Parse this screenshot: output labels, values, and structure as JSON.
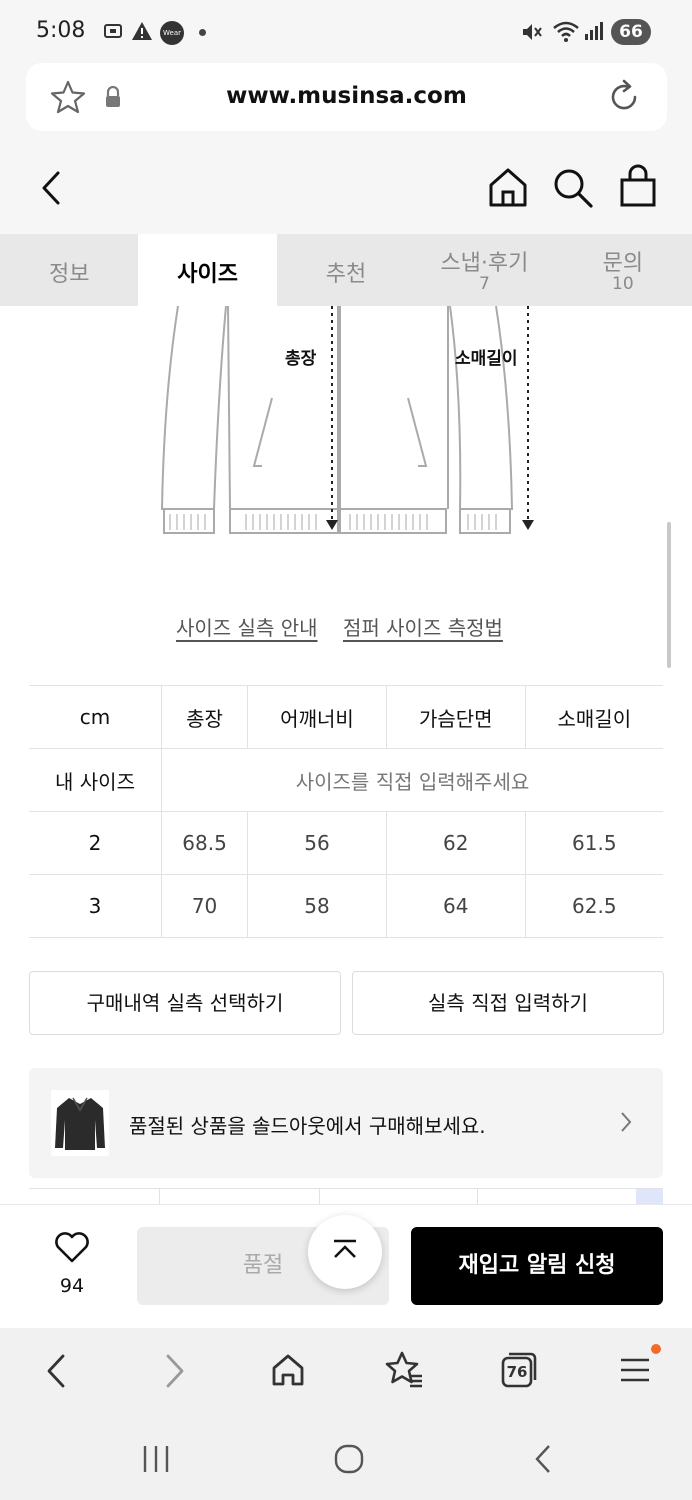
{
  "status_bar": {
    "time": "5:08",
    "battery": "66",
    "wear_label": "Wear"
  },
  "browser": {
    "url": "www.musinsa.com",
    "tab_count": "76"
  },
  "tabs": [
    {
      "label": "정보",
      "count": ""
    },
    {
      "label": "사이즈",
      "count": ""
    },
    {
      "label": "추천",
      "count": ""
    },
    {
      "label": "스냅·후기",
      "count": "7"
    },
    {
      "label": "문의",
      "count": "10"
    }
  ],
  "diagram": {
    "label_total_length": "총장",
    "label_sleeve_length": "소매길이"
  },
  "links": {
    "size_guide": "사이즈 실측 안내",
    "measure_method": "점퍼 사이즈 측정법"
  },
  "size_table": {
    "headers": [
      "cm",
      "총장",
      "어깨너비",
      "가슴단면",
      "소매길이"
    ],
    "my_size_label": "내 사이즈",
    "my_size_prompt": "사이즈를 직접 입력해주세요",
    "rows": [
      {
        "size": "2",
        "values": [
          "68.5",
          "56",
          "62",
          "61.5"
        ]
      },
      {
        "size": "3",
        "values": [
          "70",
          "58",
          "64",
          "62.5"
        ]
      }
    ]
  },
  "buttons": {
    "select_purchase": "구매내역 실측 선택하기",
    "direct_input": "실측 직접 입력하기",
    "sold_out": "품절",
    "restock_alert": "재입고 알림 신청"
  },
  "soldout_banner": {
    "text": "품절된 상품을 솔드아웃에서 구매해보세요."
  },
  "like": {
    "count": "94"
  },
  "colors": {
    "accent_dot": "#f26b2a",
    "primary_button": "#000000",
    "disabled_button": "#ececec"
  }
}
